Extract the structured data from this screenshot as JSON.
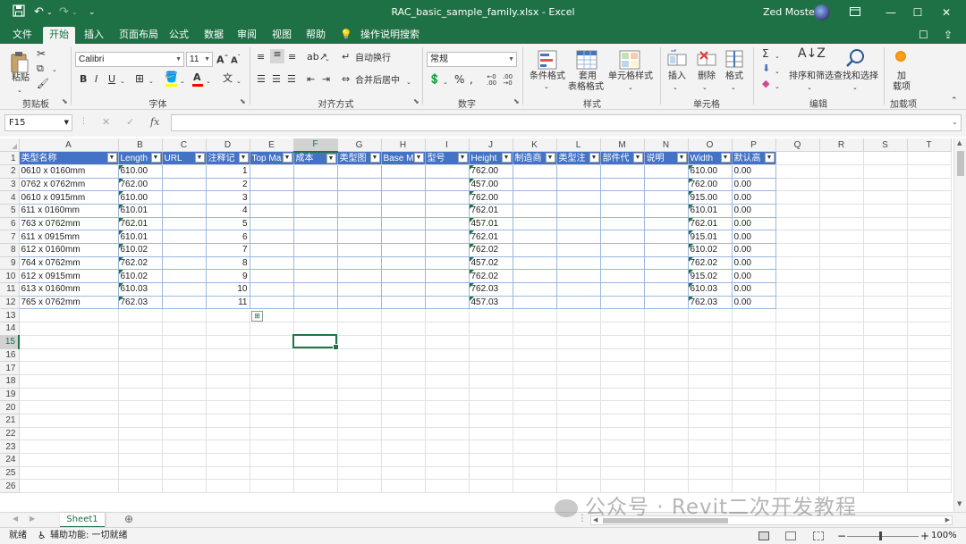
{
  "window": {
    "title": "RAC_basic_sample_family.xlsx  -  Excel",
    "user": "Zed Moster"
  },
  "ribbon_tabs": [
    "文件",
    "开始",
    "插入",
    "页面布局",
    "公式",
    "数据",
    "审阅",
    "视图",
    "帮助",
    "操作说明搜索"
  ],
  "ribbon": {
    "clipboard": {
      "paste": "粘贴",
      "group": "剪贴板"
    },
    "font": {
      "name": "Calibri",
      "size": "11",
      "group": "字体"
    },
    "alignment": {
      "wrap": "自动换行",
      "merge": "合并后居中",
      "group": "对齐方式"
    },
    "number": {
      "format": "常规",
      "group": "数字"
    },
    "styles": {
      "conditional": "条件格式",
      "table": "套用",
      "table2": "表格格式",
      "cell_styles": "单元格样式",
      "group": "样式"
    },
    "cells": {
      "insert": "插入",
      "delete": "删除",
      "format": "格式",
      "group": "单元格"
    },
    "editing": {
      "sort": "排序和筛选",
      "find": "查找和选择",
      "group": "编辑"
    },
    "addins": {
      "label": "加",
      "label2": "载项",
      "group": "加载项"
    }
  },
  "formula_bar": {
    "name_box": "F15",
    "fx": "fx",
    "formula": ""
  },
  "grid": {
    "columns": [
      "A",
      "B",
      "C",
      "D",
      "E",
      "F",
      "G",
      "H",
      "I",
      "J",
      "K",
      "L",
      "M",
      "N",
      "O",
      "P",
      "Q",
      "R",
      "S",
      "T"
    ],
    "selected_column": "F",
    "selected_row": "15",
    "header_row": [
      "类型名称",
      "Length",
      "URL",
      "注释记",
      "Top Ma",
      "成本",
      "类型图",
      "Base M",
      "型号",
      "Height",
      "制造商",
      "类型注",
      "部件代",
      "说明",
      "Width",
      "默认高"
    ],
    "rows": [
      [
        "0610 x 0160mm",
        "610.00",
        "",
        "1",
        "",
        "",
        "",
        "",
        "",
        "762.00",
        "",
        "",
        "",
        "",
        "610.00",
        "0.00"
      ],
      [
        "0762 x 0762mm",
        "762.00",
        "",
        "2",
        "",
        "",
        "",
        "",
        "",
        "457.00",
        "",
        "",
        "",
        "",
        "762.00",
        "0.00"
      ],
      [
        "0610 x 0915mm",
        "610.00",
        "",
        "3",
        "",
        "",
        "",
        "",
        "",
        "762.00",
        "",
        "",
        "",
        "",
        "915.00",
        "0.00"
      ],
      [
        "611 x 0160mm",
        "610.01",
        "",
        "4",
        "",
        "",
        "",
        "",
        "",
        "762.01",
        "",
        "",
        "",
        "",
        "610.01",
        "0.00"
      ],
      [
        "763 x 0762mm",
        "762.01",
        "",
        "5",
        "",
        "",
        "",
        "",
        "",
        "457.01",
        "",
        "",
        "",
        "",
        "762.01",
        "0.00"
      ],
      [
        "611 x 0915mm",
        "610.01",
        "",
        "6",
        "",
        "",
        "",
        "",
        "",
        "762.01",
        "",
        "",
        "",
        "",
        "915.01",
        "0.00"
      ],
      [
        "612 x 0160mm",
        "610.02",
        "",
        "7",
        "",
        "",
        "",
        "",
        "",
        "762.02",
        "",
        "",
        "",
        "",
        "610.02",
        "0.00"
      ],
      [
        "764 x 0762mm",
        "762.02",
        "",
        "8",
        "",
        "",
        "",
        "",
        "",
        "457.02",
        "",
        "",
        "",
        "",
        "762.02",
        "0.00"
      ],
      [
        "612 x 0915mm",
        "610.02",
        "",
        "9",
        "",
        "",
        "",
        "",
        "",
        "762.02",
        "",
        "",
        "",
        "",
        "915.02",
        "0.00"
      ],
      [
        "613 x 0160mm",
        "610.03",
        "",
        "10",
        "",
        "",
        "",
        "",
        "",
        "762.03",
        "",
        "",
        "",
        "",
        "610.03",
        "0.00"
      ],
      [
        "765 x 0762mm",
        "762.03",
        "",
        "11",
        "",
        "",
        "",
        "",
        "",
        "457.03",
        "",
        "",
        "",
        "",
        "762.03",
        "0.00"
      ]
    ],
    "row_count": 26
  },
  "sheet_tabs": [
    "Sheet1"
  ],
  "status": {
    "ready": "就绪",
    "accessibility": "辅助功能: 一切就绪",
    "zoom": "100%"
  },
  "watermark": "公众号 · Revit二次开发教程",
  "colors": {
    "excel_green": "#1e7145",
    "table_header": "#4472c4",
    "selection": "#217346"
  }
}
